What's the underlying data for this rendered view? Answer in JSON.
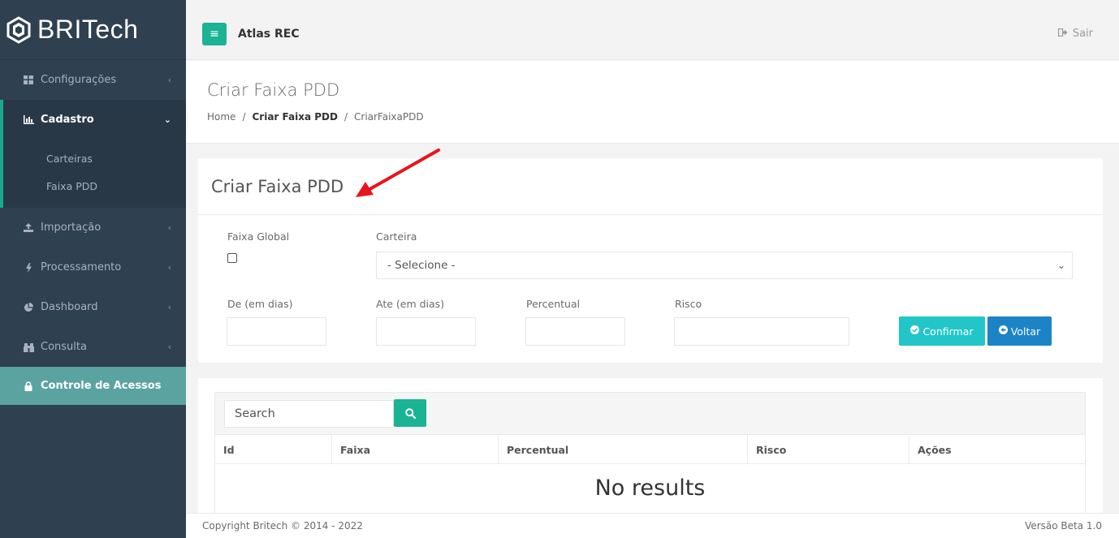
{
  "brand": {
    "name": "BRITech"
  },
  "sidebar": {
    "items": [
      {
        "label": "Configurações",
        "icon": "grid-icon"
      },
      {
        "label": "Cadastro",
        "icon": "chart-icon",
        "active": true,
        "children": [
          {
            "label": "Carteiras"
          },
          {
            "label": "Faixa PDD"
          }
        ]
      },
      {
        "label": "Importação",
        "icon": "upload-icon"
      },
      {
        "label": "Processamento",
        "icon": "bolt-icon"
      },
      {
        "label": "Dashboard",
        "icon": "pie-icon"
      },
      {
        "label": "Consulta",
        "icon": "binoculars-icon"
      },
      {
        "label": "Controle de Acessos",
        "icon": "lock-icon",
        "highlight": true
      }
    ]
  },
  "topbar": {
    "app_title": "Atlas REC",
    "logout_label": "Sair"
  },
  "page": {
    "title": "Criar Faixa PDD",
    "breadcrumb": [
      "Home",
      "Criar Faixa PDD",
      "CriarFaixaPDD"
    ]
  },
  "form": {
    "title": "Criar Faixa PDD",
    "faixa_global_label": "Faixa Global",
    "faixa_global_checked": false,
    "carteira_label": "Carteira",
    "carteira_value": "- Selecione -",
    "de_label": "De (em dias)",
    "ate_label": "Ate (em dias)",
    "percentual_label": "Percentual",
    "risco_label": "Risco",
    "confirm_label": "Confirmar",
    "back_label": "Voltar"
  },
  "table": {
    "search_placeholder": "Search",
    "columns": [
      "Id",
      "Faixa",
      "Percentual",
      "Risco",
      "Ações"
    ],
    "empty_text": "No results"
  },
  "footer": {
    "copyright": "Copyright Britech © 2014 - 2022",
    "version": "Versão Beta 1.0"
  },
  "colors": {
    "sidebar": "#2f4050",
    "accent": "#1ab394",
    "confirm": "#23c6c8",
    "back": "#1c84c6",
    "highlight": "#5ba3a0",
    "annotation": "#e8141b"
  }
}
